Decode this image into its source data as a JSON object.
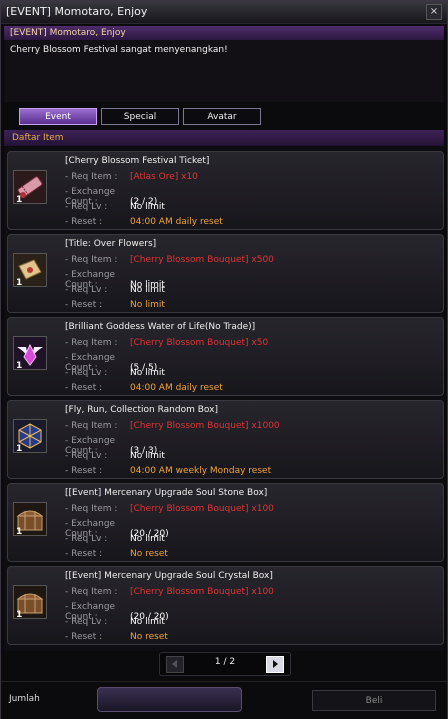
{
  "window": {
    "title": "[EVENT] Momotaro, Enjoy",
    "close_glyph": "×"
  },
  "info": {
    "header": "[EVENT] Momotaro, Enjoy",
    "text": "Cherry Blossom Festival sangat menyenangkan!"
  },
  "tabs": [
    {
      "label": "Event",
      "active": true
    },
    {
      "label": "Special",
      "active": false
    },
    {
      "label": "Avatar",
      "active": false
    }
  ],
  "list_header": "Daftar Item",
  "row_labels": {
    "req_item": "- Req Item :",
    "exchange_count": "- Exchange Count :",
    "req_lv": "- Req Lv :",
    "reset": "- Reset :"
  },
  "items": [
    {
      "name": "[Cherry Blossom Festival Ticket]",
      "qty": "1",
      "icon": "ticket-icon",
      "req_item": "[Atlas Ore] x10",
      "exchange_count": "(2 / 2)",
      "req_lv": "No limit",
      "reset": "04:00 AM daily reset"
    },
    {
      "name": "[Title: Over Flowers]",
      "qty": "1",
      "icon": "title-scroll-icon",
      "req_item": "[Cherry Blossom Bouquet] x500",
      "exchange_count": "No limit",
      "req_lv": "No limit",
      "reset": "No limit"
    },
    {
      "name": "[Brilliant Goddess Water of Life(No Trade)]",
      "qty": "1",
      "icon": "goddess-water-icon",
      "req_item": "[Cherry Blossom Bouquet] x50",
      "exchange_count": "(5 / 5)",
      "req_lv": "No limit",
      "reset": "04:00 AM daily reset"
    },
    {
      "name": "[Fly, Run, Collection Random Box]",
      "qty": "1",
      "icon": "random-box-icon",
      "req_item": "[Cherry Blossom Bouquet] x1000",
      "exchange_count": "(3 / 3)",
      "req_lv": "No limit",
      "reset": "04:00 AM weekly Monday reset"
    },
    {
      "name": "[[Event] Mercenary Upgrade Soul Stone Box]",
      "qty": "1",
      "icon": "treasure-chest-icon",
      "req_item": "[Cherry Blossom Bouquet] x100",
      "exchange_count": "(20 / 20)",
      "req_lv": "No limit",
      "reset": "No reset"
    },
    {
      "name": "[[Event] Mercenary Upgrade Soul Crystal Box]",
      "qty": "1",
      "icon": "treasure-chest-icon",
      "req_item": "[Cherry Blossom Bouquet] x100",
      "exchange_count": "(20 / 20)",
      "req_lv": "No limit",
      "reset": "No reset"
    }
  ],
  "pagination": {
    "current": "1 / 2"
  },
  "footer": {
    "quantity_label": "Jumlah",
    "quantity_value": "",
    "buy_label": "Beli"
  }
}
